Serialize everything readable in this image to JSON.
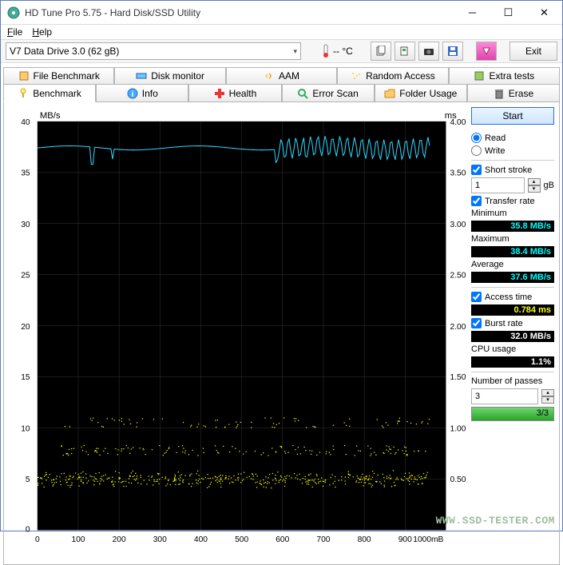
{
  "window": {
    "title": "HD Tune Pro 5.75 - Hard Disk/SSD Utility"
  },
  "menu": {
    "file": "File",
    "help": "Help"
  },
  "toolbar": {
    "drive": "V7    Data Drive 3.0 (62 gB)",
    "temp": "-- °C",
    "exit": "Exit"
  },
  "tabs_top": [
    "File Benchmark",
    "Disk monitor",
    "AAM",
    "Random Access",
    "Extra tests"
  ],
  "tabs_bottom": [
    "Benchmark",
    "Info",
    "Health",
    "Error Scan",
    "Folder Usage",
    "Erase"
  ],
  "side": {
    "start": "Start",
    "read": "Read",
    "write": "Write",
    "short_stroke": "Short stroke",
    "short_stroke_val": "1",
    "short_stroke_unit": "gB",
    "transfer_rate": "Transfer rate",
    "minimum": "Minimum",
    "minimum_val": "35.8 MB/s",
    "maximum": "Maximum",
    "maximum_val": "38.4 MB/s",
    "average": "Average",
    "average_val": "37.6 MB/s",
    "access_time": "Access time",
    "access_time_val": "0.784 ms",
    "burst_rate": "Burst rate",
    "burst_rate_val": "32.0 MB/s",
    "cpu_usage": "CPU usage",
    "cpu_usage_val": "1.1%",
    "passes": "Number of passes",
    "passes_val": "3",
    "progress": "3/3"
  },
  "chart_data": {
    "type": "line+scatter",
    "xlabel": "mB",
    "ylabel_left": "MB/s",
    "ylabel_right": "ms",
    "x_range": [
      0,
      1000
    ],
    "x_ticks": [
      0,
      100,
      200,
      300,
      400,
      500,
      600,
      700,
      800,
      900,
      1000
    ],
    "y_left_range": [
      0,
      40
    ],
    "y_left_ticks": [
      0,
      5,
      10,
      15,
      20,
      25,
      30,
      35,
      40
    ],
    "y_right_range": [
      0,
      4.0
    ],
    "y_right_ticks": [
      0.5,
      1.0,
      1.5,
      2.0,
      2.5,
      3.0,
      3.5,
      4.0
    ],
    "series": [
      {
        "name": "Transfer rate (MB/s)",
        "axis": "left",
        "style": "line",
        "color": "#00bfff",
        "y_baseline": 37.5,
        "y_variation": 0.8,
        "notes": "Flat line ~37-38 MB/s with small spikes and oscillation after x≈600"
      },
      {
        "name": "Access time (ms)",
        "axis": "right",
        "style": "scatter",
        "color": "#ffff00",
        "bands": [
          {
            "y_center": 0.5,
            "spread": 0.05,
            "density": "dense",
            "x_range": [
              0,
              960
            ]
          },
          {
            "y_center": 0.78,
            "spread": 0.05,
            "density": "medium",
            "x_range": [
              50,
              960
            ]
          },
          {
            "y_center": 1.05,
            "spread": 0.05,
            "density": "sparse",
            "x_range": [
              50,
              960
            ]
          }
        ]
      }
    ]
  },
  "watermark": "WWW.SSD-TESTER.COM"
}
